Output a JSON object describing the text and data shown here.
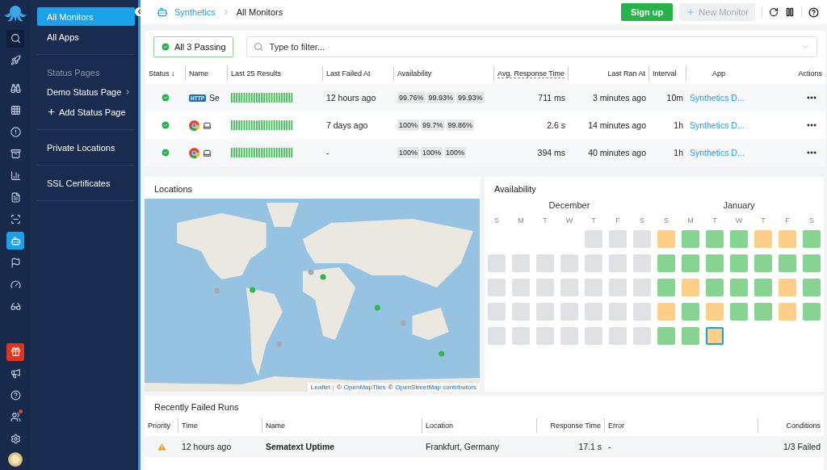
{
  "rail": {
    "top": [
      {
        "selected": false
      },
      {
        "selected": false
      },
      {
        "selected": false
      },
      {
        "selected": false
      },
      {
        "selected": false
      },
      {
        "selected": false
      },
      {
        "selected": false
      },
      {
        "selected": false
      },
      {
        "selected": false
      },
      {
        "selected": true
      },
      {
        "selected": false
      },
      {
        "selected": false
      },
      {
        "selected": false
      }
    ],
    "bottom": [
      {
        "kind": "promo"
      },
      {
        "kind": "plain"
      },
      {
        "kind": "plain"
      },
      {
        "kind": "notify"
      },
      {
        "kind": "plain"
      },
      {
        "kind": "avatar"
      }
    ]
  },
  "nav": {
    "groups": [
      {
        "items": [
          {
            "label": "All Monitors",
            "selected": true,
            "kind": "link"
          },
          {
            "label": "All Apps",
            "selected": false,
            "kind": "link"
          }
        ]
      },
      {
        "heading": "Status Pages",
        "items": [
          {
            "label": "Demo Status Page",
            "selected": false,
            "kind": "submenu"
          },
          {
            "label": "Add Status Page",
            "selected": false,
            "kind": "add"
          }
        ]
      },
      {
        "items": [
          {
            "label": "Private Locations",
            "selected": false,
            "kind": "link"
          }
        ]
      },
      {
        "items": [
          {
            "label": "SSL Certificates",
            "selected": false,
            "kind": "link"
          }
        ]
      }
    ]
  },
  "breadcrumb": [
    "Synthetics",
    "All Monitors"
  ],
  "toolbar": {
    "signup": "Sign up",
    "new_monitor": {
      "label": "New Monitor",
      "disabled": true
    }
  },
  "monitors": {
    "passing": "All 3 Passing",
    "filter_placeholder": "Type to filter...",
    "columns": [
      "Status ↓",
      "Name",
      "Last 25 Results",
      "Last Failed At",
      "Availability",
      "Avg. Response Time",
      "Last Ran At",
      "Interval",
      "App",
      "Actions"
    ],
    "rows": [
      {
        "kind": "http",
        "badge": "HTTP",
        "name": "Se",
        "last_failed": "12 hours ago",
        "availability": [
          "99.76%",
          "99.93%",
          "99.93%"
        ],
        "response": "711 ms",
        "last_ran": "3 minutes ago",
        "interval": "10m",
        "app": "Synthetics D..."
      },
      {
        "kind": "browser",
        "last_failed": "7 days ago",
        "availability": [
          "100%",
          "99.7%",
          "99.86%"
        ],
        "response": "2.6 s",
        "last_ran": "14 minutes ago",
        "interval": "1h",
        "app": "Synthetics D..."
      },
      {
        "kind": "browser",
        "last_failed": "-",
        "availability": [
          "100%",
          "100%",
          "100%"
        ],
        "response": "394 ms",
        "last_ran": "40 minutes ago",
        "interval": "1h",
        "app": "Synthetics D..."
      }
    ]
  },
  "locations": {
    "title": "Locations",
    "attribution": {
      "leaflet": "Leaflet",
      "separator": "|",
      "sources": [
        {
          "symbol": "©",
          "label": "OpenMapTiles"
        },
        {
          "symbol": "©",
          "label": "OpenStreetMap contributors"
        }
      ]
    }
  },
  "availability": {
    "title": "Availability",
    "months": [
      "December",
      "January"
    ],
    "weekdays": [
      "S",
      "M",
      "T",
      "W",
      "T",
      "F",
      "S",
      "S",
      "M",
      "T",
      "W",
      "T",
      "F",
      "S"
    ],
    "weeks": [
      [
        {
          "kind": "empty",
          "selected": false
        },
        {
          "kind": "empty",
          "selected": false
        },
        {
          "kind": "empty",
          "selected": false
        },
        {
          "kind": "empty",
          "selected": false
        },
        {
          "kind": "none",
          "selected": false
        },
        {
          "kind": "none",
          "selected": false
        },
        {
          "kind": "none",
          "selected": false
        },
        {
          "kind": "warn",
          "selected": false
        },
        {
          "kind": "ok",
          "selected": false
        },
        {
          "kind": "ok",
          "selected": false
        },
        {
          "kind": "ok",
          "selected": false
        },
        {
          "kind": "warn",
          "selected": false
        },
        {
          "kind": "warn",
          "selected": false
        },
        {
          "kind": "ok",
          "selected": false
        }
      ],
      [
        {
          "kind": "none",
          "selected": false
        },
        {
          "kind": "none",
          "selected": false
        },
        {
          "kind": "none",
          "selected": false
        },
        {
          "kind": "none",
          "selected": false
        },
        {
          "kind": "none",
          "selected": false
        },
        {
          "kind": "none",
          "selected": false
        },
        {
          "kind": "none",
          "selected": false
        },
        {
          "kind": "ok",
          "selected": false
        },
        {
          "kind": "ok",
          "selected": false
        },
        {
          "kind": "ok",
          "selected": false
        },
        {
          "kind": "ok",
          "selected": false
        },
        {
          "kind": "ok",
          "selected": false
        },
        {
          "kind": "ok",
          "selected": false
        },
        {
          "kind": "ok",
          "selected": false
        }
      ],
      [
        {
          "kind": "none",
          "selected": false
        },
        {
          "kind": "none",
          "selected": false
        },
        {
          "kind": "none",
          "selected": false
        },
        {
          "kind": "none",
          "selected": false
        },
        {
          "kind": "none",
          "selected": false
        },
        {
          "kind": "none",
          "selected": false
        },
        {
          "kind": "none",
          "selected": false
        },
        {
          "kind": "ok",
          "selected": false
        },
        {
          "kind": "warn",
          "selected": false
        },
        {
          "kind": "ok",
          "selected": false
        },
        {
          "kind": "ok",
          "selected": false
        },
        {
          "kind": "ok",
          "selected": false
        },
        {
          "kind": "warn",
          "selected": false
        },
        {
          "kind": "ok",
          "selected": false
        }
      ],
      [
        {
          "kind": "none",
          "selected": false
        },
        {
          "kind": "none",
          "selected": false
        },
        {
          "kind": "none",
          "selected": false
        },
        {
          "kind": "none",
          "selected": false
        },
        {
          "kind": "none",
          "selected": false
        },
        {
          "kind": "none",
          "selected": false
        },
        {
          "kind": "none",
          "selected": false
        },
        {
          "kind": "warn",
          "selected": false
        },
        {
          "kind": "ok",
          "selected": false
        },
        {
          "kind": "warn",
          "selected": false
        },
        {
          "kind": "ok",
          "selected": false
        },
        {
          "kind": "ok",
          "selected": false
        },
        {
          "kind": "warn",
          "selected": false
        },
        {
          "kind": "ok",
          "selected": false
        }
      ],
      [
        {
          "kind": "none",
          "selected": false
        },
        {
          "kind": "none",
          "selected": false
        },
        {
          "kind": "none",
          "selected": false
        },
        {
          "kind": "none",
          "selected": false
        },
        {
          "kind": "none",
          "selected": false
        },
        {
          "kind": "none",
          "selected": false
        },
        {
          "kind": "none",
          "selected": false
        },
        {
          "kind": "ok",
          "selected": false
        },
        {
          "kind": "ok",
          "selected": false
        },
        {
          "kind": "warn",
          "selected": true
        },
        {
          "kind": "empty",
          "selected": false
        },
        {
          "kind": "empty",
          "selected": false
        },
        {
          "kind": "empty",
          "selected": false
        },
        {
          "kind": "empty",
          "selected": false
        }
      ]
    ]
  },
  "failed_runs": {
    "title": "Recently Failed Runs",
    "columns": [
      "Priority",
      "Time",
      "Name",
      "Location",
      "Response Time",
      "Error",
      "Conditions"
    ],
    "rows": [
      {
        "kind": "warning",
        "time": "12 hours ago",
        "name": "Sematext Uptime",
        "location": "Frankfurt, Germany",
        "response": "17.1 s",
        "error": "-",
        "conditions": "1/3 Failed"
      }
    ]
  }
}
